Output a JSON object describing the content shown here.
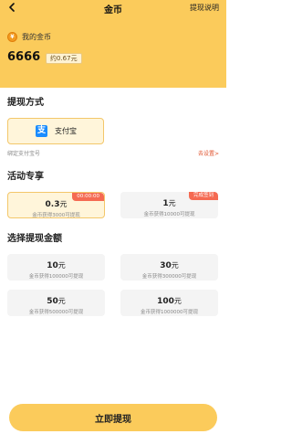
{
  "header": {
    "title": "金币",
    "help_label": "提现说明",
    "coin_label": "我的金币",
    "coin_count": "6666",
    "coin_approx": "约0.67元"
  },
  "withdraw_method": {
    "title": "提现方式",
    "alipay_label": "支付宝",
    "alipay_icon_char": "支",
    "bound_note": "绑定支付宝号",
    "goto_setting": "去设置>"
  },
  "activity": {
    "title": "活动专享",
    "cards": [
      {
        "amount": "0.3",
        "unit": "元",
        "desc": "金币获得3000可提现",
        "tag": "00:00:00"
      },
      {
        "amount": "1",
        "unit": "元",
        "desc": "金币获得10000可提现",
        "tag": "完成签到"
      }
    ]
  },
  "amounts": {
    "title": "选择提现金额",
    "cards": [
      {
        "amount": "10",
        "unit": "元",
        "desc": "金币获得100000可提现"
      },
      {
        "amount": "30",
        "unit": "元",
        "desc": "金币获得300000可提现"
      },
      {
        "amount": "50",
        "unit": "元",
        "desc": "金币获得500000可提现"
      },
      {
        "amount": "100",
        "unit": "元",
        "desc": "金币获得1000000可提现"
      }
    ]
  },
  "footer": {
    "submit_label": "立即提现"
  },
  "colors": {
    "brand": "#FBCB5B",
    "selected_bg": "#FFF5DA",
    "tag": "#F56A52",
    "alipay": "#1A8CFF"
  }
}
